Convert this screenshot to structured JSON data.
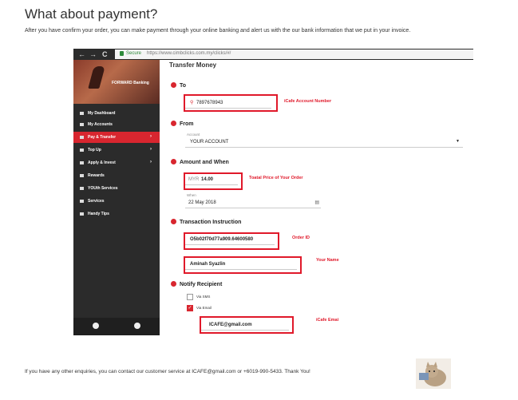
{
  "page": {
    "title": "What about payment?",
    "intro": "After you have confirm your order, you can make payment through your online banking and alert us with the our bank information that we put in your invoice.",
    "footer": "If you have any other enquiries, you can contact our customer service at ICAFE@gmail.com or +6019-990-5433. Thank You!"
  },
  "browser": {
    "back": "←",
    "forward": "→",
    "reload": "C",
    "secure_label": "Secure",
    "url": "https://www.cimbclicks.com.my/clicks/#/"
  },
  "sidebar": {
    "brand": "FORWARD Banking",
    "items": [
      {
        "label": "My Dashboard",
        "chevron": ""
      },
      {
        "label": "My Accounts",
        "chevron": ""
      },
      {
        "label": "Pay & Transfer",
        "chevron": "›"
      },
      {
        "label": "Top Up",
        "chevron": "›"
      },
      {
        "label": "Apply & Invest",
        "chevron": "›"
      },
      {
        "label": "Rewards",
        "chevron": ""
      },
      {
        "label": "YOUth Services",
        "chevron": ""
      },
      {
        "label": "Services",
        "chevron": ""
      },
      {
        "label": "Handy Tips",
        "chevron": ""
      }
    ]
  },
  "form": {
    "panel_title": "Transfer Money",
    "to": {
      "section": "To",
      "value": "7897678943",
      "annotation": "iCafe Account Number"
    },
    "from": {
      "section": "From",
      "account_label": "Account",
      "account_value": "YOUR ACCOUNT"
    },
    "amount": {
      "section": "Amount and When",
      "currency": "MYR",
      "value": "14.00",
      "annotation": "Toatal Price of Your Order",
      "when_label": "When",
      "when_value": "22 May 2018"
    },
    "instruction": {
      "section": "Transaction Instruction",
      "order_value": "O5b02f70d77a909.64600580",
      "order_annotation": "Order ID",
      "name_value": "Aminah Syazlin",
      "name_annotation": "Your Name"
    },
    "notify": {
      "section": "Notify Recipient",
      "sms_label": "Via SMS",
      "email_label": "Via Email",
      "email_value": "ICAFE@gmail.com",
      "email_annotation": "iCafe Emai"
    }
  },
  "colors": {
    "accent": "#d8262f",
    "annotation": "#e0192a",
    "sidebar": "#2b2b2b"
  }
}
